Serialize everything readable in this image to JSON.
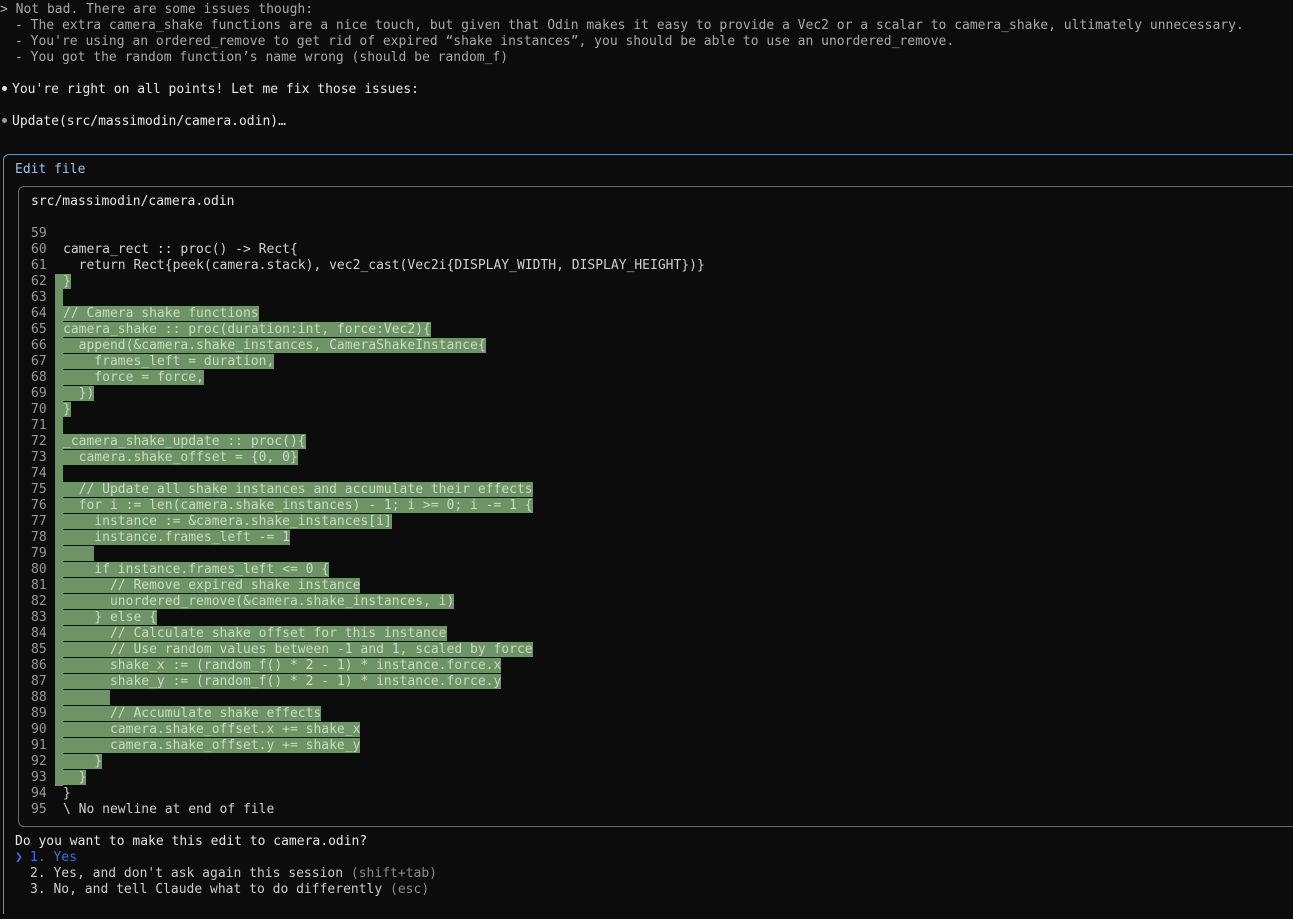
{
  "user_message": {
    "prompt_marker": ">",
    "lines": [
      "Not bad. There are some issues though:",
      "- The extra camera_shake functions are a nice touch, but given that Odin makes it easy to provide a Vec2 or a scalar to camera_shake, ultimately unnecessary.",
      "- You're using an ordered_remove to get rid of expired “shake instances”, you should be able to use an unordered_remove.",
      "- You got the random function’s name wrong (should be random_f)"
    ]
  },
  "assistant_reply": "You're right on all points! Let me fix those issues:",
  "tool_call": "Update(src/massimodin/camera.odin)…",
  "edit_panel": {
    "title": "Edit file",
    "file_path": "src/massimodin/camera.odin",
    "diff": [
      {
        "n": "59",
        "text": "",
        "hl": false
      },
      {
        "n": "60",
        "text": "camera_rect :: proc() -> Rect{",
        "hl": false
      },
      {
        "n": "61",
        "text": "  return Rect{peek(camera.stack), vec2_cast(Vec2i{DISPLAY_WIDTH, DISPLAY_HEIGHT})}",
        "hl": false
      },
      {
        "n": "62",
        "text": "}",
        "hl": true
      },
      {
        "n": "63",
        "text": "",
        "hl": true
      },
      {
        "n": "64",
        "text": "// Camera shake functions",
        "hl": true
      },
      {
        "n": "65",
        "text": "camera_shake :: proc(duration:int, force:Vec2){",
        "hl": true
      },
      {
        "n": "66",
        "text": "  append(&camera.shake_instances, CameraShakeInstance{",
        "hl": true
      },
      {
        "n": "67",
        "text": "    frames_left = duration,",
        "hl": true
      },
      {
        "n": "68",
        "text": "    force = force,",
        "hl": true
      },
      {
        "n": "69",
        "text": "  })",
        "hl": true
      },
      {
        "n": "70",
        "text": "}",
        "hl": true
      },
      {
        "n": "71",
        "text": "",
        "hl": true
      },
      {
        "n": "72",
        "text": "_camera_shake_update :: proc(){",
        "hl": true
      },
      {
        "n": "73",
        "text": "  camera.shake_offset = {0, 0}",
        "hl": true
      },
      {
        "n": "74",
        "text": "",
        "hl": true
      },
      {
        "n": "75",
        "text": "  // Update all shake instances and accumulate their effects",
        "hl": true
      },
      {
        "n": "76",
        "text": "  for i := len(camera.shake_instances) - 1; i >= 0; i -= 1 {",
        "hl": true
      },
      {
        "n": "77",
        "text": "    instance := &camera.shake_instances[i]",
        "hl": true
      },
      {
        "n": "78",
        "text": "    instance.frames_left -= 1",
        "hl": true
      },
      {
        "n": "79",
        "text": "    ",
        "hl": true
      },
      {
        "n": "80",
        "text": "    if instance.frames_left <= 0 {",
        "hl": true
      },
      {
        "n": "81",
        "text": "      // Remove expired shake instance",
        "hl": true
      },
      {
        "n": "82",
        "text": "      unordered_remove(&camera.shake_instances, i)",
        "hl": true
      },
      {
        "n": "83",
        "text": "    } else {",
        "hl": true
      },
      {
        "n": "84",
        "text": "      // Calculate shake offset for this instance",
        "hl": true
      },
      {
        "n": "85",
        "text": "      // Use random values between -1 and 1, scaled by force",
        "hl": true
      },
      {
        "n": "86",
        "text": "      shake_x := (random_f() * 2 - 1) * instance.force.x",
        "hl": true
      },
      {
        "n": "87",
        "text": "      shake_y := (random_f() * 2 - 1) * instance.force.y",
        "hl": true
      },
      {
        "n": "88",
        "text": "      ",
        "hl": true
      },
      {
        "n": "89",
        "text": "      // Accumulate shake effects",
        "hl": true
      },
      {
        "n": "90",
        "text": "      camera.shake_offset.x += shake_x",
        "hl": true
      },
      {
        "n": "91",
        "text": "      camera.shake_offset.y += shake_y",
        "hl": true
      },
      {
        "n": "92",
        "text": "    }",
        "hl": true
      },
      {
        "n": "93",
        "text": "  }",
        "hl": true
      },
      {
        "n": "94",
        "text": "}",
        "hl": false
      },
      {
        "n": "95",
        "text": "\\ No newline at end of file",
        "hl": false
      }
    ]
  },
  "question": "Do you want to make this edit to camera.odin?",
  "options": [
    {
      "marker": "❯",
      "label": "1. Yes",
      "hint": "",
      "selected": true
    },
    {
      "marker": "",
      "label": "2. Yes, and don't ask again this session",
      "hint": "(shift+tab)",
      "selected": false
    },
    {
      "marker": "",
      "label": "3. No, and tell Claude what to do differently",
      "hint": "(esc)",
      "selected": false
    }
  ],
  "colors": {
    "background": "#0c0c0c",
    "diff_added": "#6e9366",
    "panel_border": "#6b8fb8",
    "selected_option": "#3f6fe0",
    "bullet_done": "#e6e6e6",
    "bullet_tool": "#9a9a9a"
  }
}
